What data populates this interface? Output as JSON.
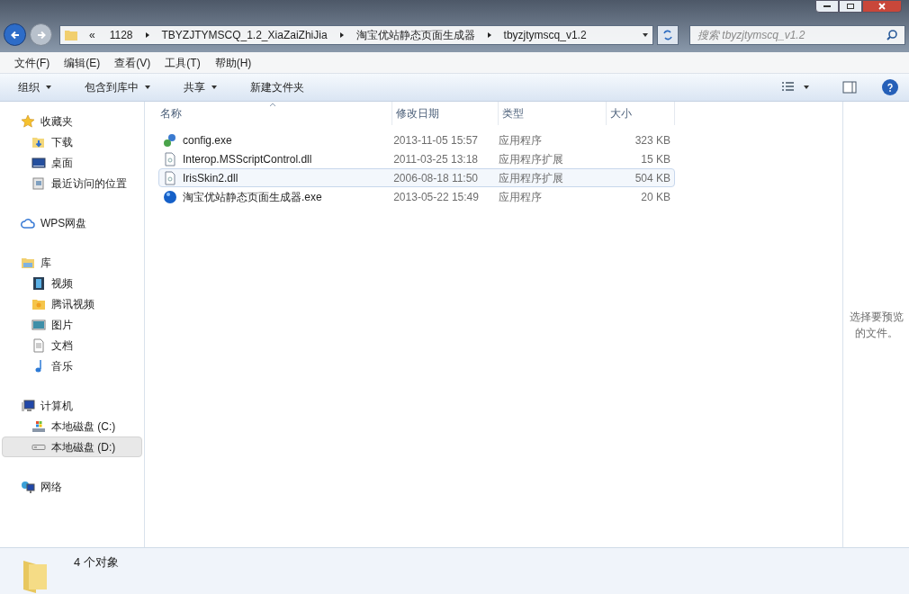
{
  "address": {
    "crumbs": [
      "«",
      "1128",
      "TBYZJTYMSCQ_1.2_XiaZaiZhiJia",
      "淘宝优站静态页面生成器",
      "tbyzjtymscq_v1.2"
    ]
  },
  "search": {
    "placeholder": "搜索 tbyzjtymscq_v1.2"
  },
  "menu": [
    "文件(F)",
    "编辑(E)",
    "查看(V)",
    "工具(T)",
    "帮助(H)"
  ],
  "toolbar": [
    {
      "label": "组织",
      "dropdown": true
    },
    {
      "label": "包含到库中",
      "dropdown": true
    },
    {
      "label": "共享",
      "dropdown": true
    },
    {
      "label": "新建文件夹",
      "dropdown": false
    }
  ],
  "sidebar": [
    {
      "label": "收藏夹",
      "kind": "star",
      "selected": false,
      "children": [
        {
          "label": "下载",
          "kind": "download",
          "selected": false
        },
        {
          "label": "桌面",
          "kind": "desktop",
          "selected": false
        },
        {
          "label": "最近访问的位置",
          "kind": "recent",
          "selected": false
        }
      ]
    },
    {
      "label": "WPS网盘",
      "kind": "cloud",
      "selected": false
    },
    {
      "label": "库",
      "kind": "library",
      "selected": false,
      "children": [
        {
          "label": "视频",
          "kind": "video",
          "selected": false
        },
        {
          "label": "腾讯视频",
          "kind": "folder",
          "selected": false
        },
        {
          "label": "图片",
          "kind": "picture",
          "selected": false
        },
        {
          "label": "文档",
          "kind": "document",
          "selected": false
        },
        {
          "label": "音乐",
          "kind": "music",
          "selected": false
        }
      ]
    },
    {
      "label": "计算机",
      "kind": "computer",
      "selected": false,
      "children": [
        {
          "label": "本地磁盘 (C:)",
          "kind": "system-drive",
          "selected": false
        },
        {
          "label": "本地磁盘 (D:)",
          "kind": "drive",
          "selected": true
        }
      ]
    },
    {
      "label": "网络",
      "kind": "network",
      "selected": false
    }
  ],
  "table": {
    "columns": [
      "名称",
      "修改日期",
      "类型",
      "大小"
    ],
    "rows": [
      {
        "kind": "setup",
        "name": "config.exe",
        "date": "2013-11-05 15:57",
        "type": "应用程序",
        "size": "323 KB",
        "selected": false
      },
      {
        "kind": "library",
        "name": "Interop.MSScriptControl.dll",
        "date": "2011-03-25 13:18",
        "type": "应用程序扩展",
        "size": "15 KB",
        "selected": false
      },
      {
        "kind": "library",
        "name": "IrisSkin2.dll",
        "date": "2006-08-18 11:50",
        "type": "应用程序扩展",
        "size": "504 KB",
        "selected": true
      },
      {
        "kind": "app",
        "name": "淘宝优站静态页面生成器.exe",
        "date": "2013-05-22 15:49",
        "type": "应用程序",
        "size": "20 KB",
        "selected": false
      }
    ]
  },
  "preview": {
    "message": "选择要预览的文件。"
  },
  "status_bar": {
    "count": "4 个对象"
  }
}
